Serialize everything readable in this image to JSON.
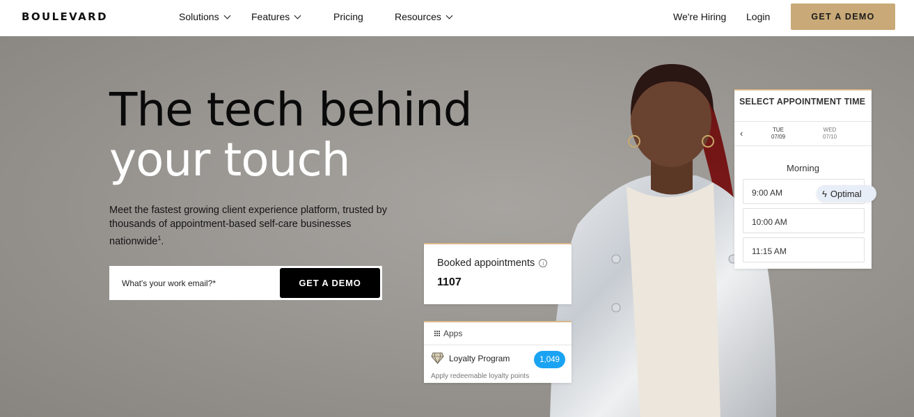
{
  "nav": {
    "logo": "BOULEVARD",
    "menu": [
      {
        "label": "Solutions",
        "dropdown": true
      },
      {
        "label": "Features",
        "dropdown": true
      },
      {
        "label": "Pricing",
        "dropdown": false
      },
      {
        "label": "Resources",
        "dropdown": true
      }
    ],
    "hiring": "We're Hiring",
    "login": "Login",
    "cta": "GET A DEMO"
  },
  "hero": {
    "headline_line1": "The tech behind",
    "headline_line2": "your touch",
    "subtext": "Meet the fastest growing client experience platform, trusted by thousands of appointment-based self-care businesses nationwide",
    "subtext_sup": "1",
    "email_placeholder": "What's your work email?*",
    "email_cta": "GET A DEMO"
  },
  "appointment_card": {
    "title": "SELECT APPOINTMENT TIME",
    "days": [
      {
        "dow": "TUE",
        "date": "07/09"
      },
      {
        "dow": "WED",
        "date": "07/10"
      }
    ],
    "section": "Morning",
    "slots": [
      "9:00 AM",
      "10:00 AM",
      "11:15 AM"
    ],
    "optimal_label": "Optimal"
  },
  "booked_card": {
    "title": "Booked appointments",
    "value": "1107"
  },
  "apps_card": {
    "header": "Apps",
    "program": "Loyalty Program",
    "count": "1,049",
    "subtitle": "Apply redeemable loyalty points"
  },
  "colors": {
    "accent": "#c8a977",
    "badge": "#1aa3f2",
    "hero_bg": "#9a9793"
  }
}
